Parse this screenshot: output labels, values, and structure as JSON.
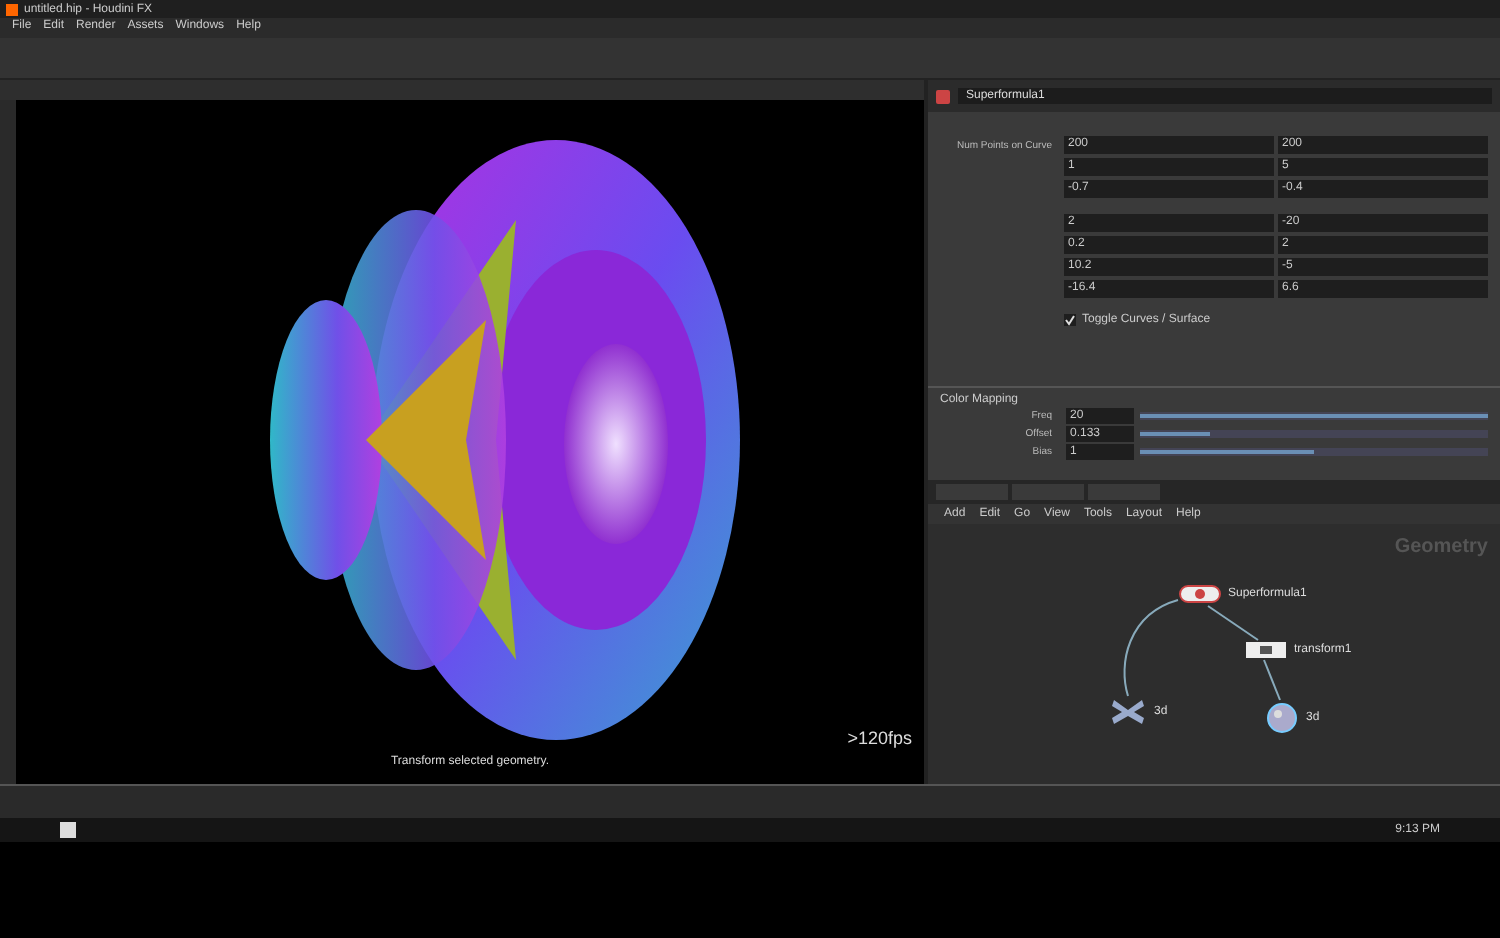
{
  "window": {
    "title": "untitled.hip - Houdini FX"
  },
  "menu": [
    "File",
    "Edit",
    "Render",
    "Assets",
    "Windows",
    "Help"
  ],
  "viewport": {
    "fps": ">120fps",
    "status": "Transform selected geometry."
  },
  "parameters": {
    "node_name": "Superformula1",
    "field_rows": [
      {
        "label": "Num Points on Curve",
        "values": [
          "200",
          "200"
        ]
      },
      {
        "values": [
          "1",
          "5"
        ]
      },
      {
        "values": [
          "-0.7",
          "-0.4"
        ]
      },
      {
        "values": [
          "2",
          "-20"
        ]
      },
      {
        "values": [
          "0.2",
          "2"
        ]
      },
      {
        "values": [
          "10.2",
          "-5"
        ]
      },
      {
        "values": [
          "-16.4",
          "6.6"
        ]
      }
    ],
    "toggle": {
      "label": "Toggle Curves / Surface",
      "checked": true
    },
    "section": "Color Mapping",
    "sliders": [
      {
        "label": "Freq",
        "value": "20",
        "level": 1
      },
      {
        "label": "Offset",
        "value": "0.133",
        "level": 0.2
      },
      {
        "label": "Bias",
        "value": "1",
        "level": 0.5
      }
    ]
  },
  "network": {
    "menu": [
      "Add",
      "Edit",
      "Go",
      "View",
      "Tools",
      "Layout",
      "Help"
    ],
    "context": "Geometry",
    "nodes": [
      {
        "label": "Superformula1",
        "kind": "generator"
      },
      {
        "label": "transform1",
        "kind": "transform"
      },
      {
        "label": "3d",
        "kind": "null"
      },
      {
        "label": "3d",
        "kind": "output"
      }
    ]
  },
  "taskbar": {
    "clock": "9:13 PM"
  }
}
